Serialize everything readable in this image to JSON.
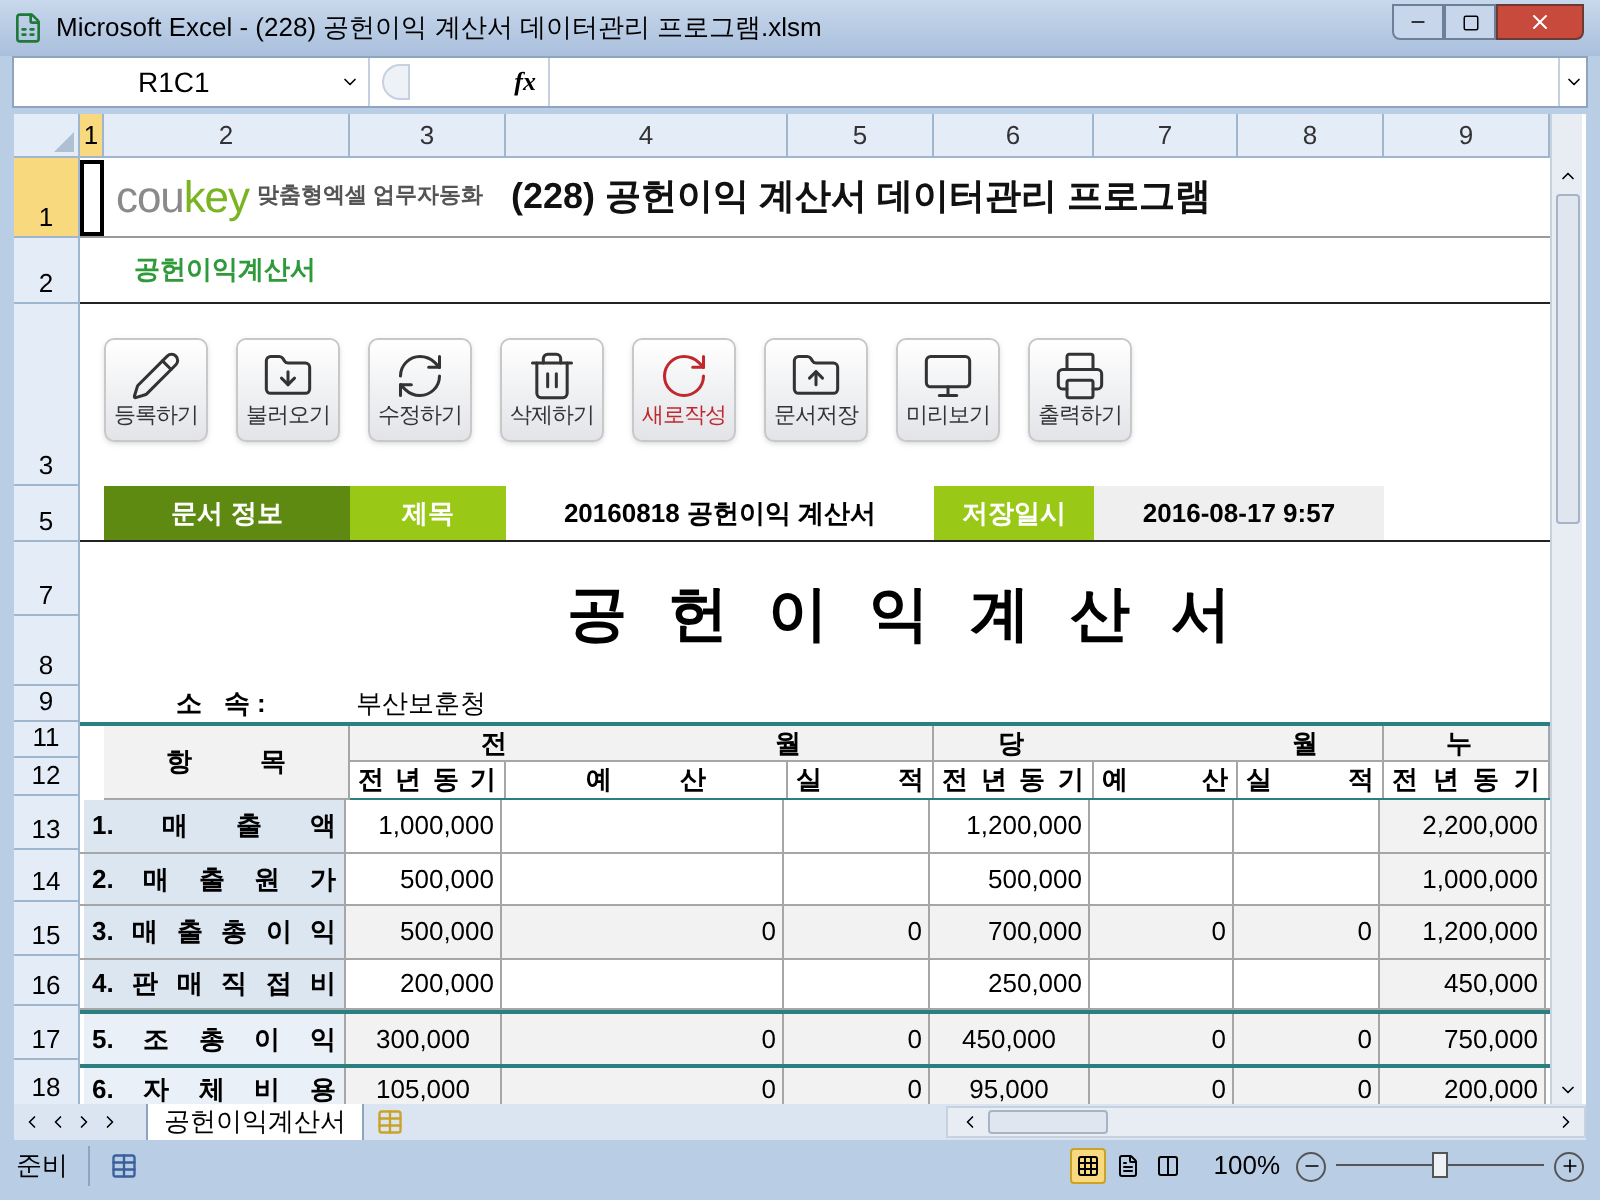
{
  "window": {
    "title": "Microsoft Excel - (228) 공헌이익 계산서 데이터관리 프로그램.xlsm"
  },
  "formula_bar": {
    "name_box": "R1C1",
    "fx": "fx"
  },
  "column_headers": [
    {
      "label": "1",
      "selected": true
    },
    {
      "label": "2",
      "selected": false
    },
    {
      "label": "3",
      "selected": false
    },
    {
      "label": "4",
      "selected": false
    },
    {
      "label": "5",
      "selected": false
    },
    {
      "label": "6",
      "selected": false
    },
    {
      "label": "7",
      "selected": false
    },
    {
      "label": "8",
      "selected": false
    },
    {
      "label": "9",
      "selected": false
    }
  ],
  "row_headers": [
    {
      "label": "1",
      "selected": true
    },
    {
      "label": "2",
      "selected": false
    },
    {
      "label": "3",
      "selected": false
    },
    {
      "label": "5",
      "selected": false
    },
    {
      "label": "7",
      "selected": false
    },
    {
      "label": "8",
      "selected": false
    },
    {
      "label": "9",
      "selected": false
    },
    {
      "label": "11",
      "selected": false
    },
    {
      "label": "12",
      "selected": false
    },
    {
      "label": "13",
      "selected": false
    },
    {
      "label": "14",
      "selected": false
    },
    {
      "label": "15",
      "selected": false
    },
    {
      "label": "16",
      "selected": false
    },
    {
      "label": "17",
      "selected": false
    },
    {
      "label": "18",
      "selected": false
    }
  ],
  "header": {
    "logo": "coukey",
    "tagline": "맞춤형엑셀 업무자동화",
    "title": "(228) 공헌이익 계산서 데이터관리 프로그램",
    "sheet_label": "공헌이익계산서"
  },
  "buttons": [
    {
      "label": "등록하기",
      "kind": "pencil",
      "color": "#333333"
    },
    {
      "label": "불러오기",
      "kind": "download",
      "color": "#333333"
    },
    {
      "label": "수정하기",
      "kind": "refresh",
      "color": "#333333"
    },
    {
      "label": "삭제하기",
      "kind": "trash",
      "color": "#333333"
    },
    {
      "label": "새로작성",
      "kind": "circle",
      "color": "#c0282d"
    },
    {
      "label": "문서저장",
      "kind": "upload",
      "color": "#333333"
    },
    {
      "label": "미리보기",
      "kind": "monitor",
      "color": "#333333"
    },
    {
      "label": "출력하기",
      "kind": "printer",
      "color": "#333333"
    }
  ],
  "info_bar": {
    "section": "문서 정보",
    "title_label": "제목",
    "title_value": "20160818 공헌이익 계산서",
    "date_label": "저장일시",
    "date_value": "2016-08-17 9:57"
  },
  "report": {
    "title": "공 헌 이 익 계 산 서",
    "dept_label": "소   속 :",
    "dept_value": "부산보훈청"
  },
  "table": {
    "item_header": "항 목",
    "groups": [
      "전 월",
      "당 월",
      "누"
    ],
    "subheaders": [
      "전 년 동 기",
      "예 산",
      "실 적",
      "전 년 동 기",
      "예 산",
      "실 적",
      "전 년 동 기"
    ],
    "rows": [
      {
        "kind": "item",
        "label": "1. 매 출 액",
        "cells": [
          "1,000,000",
          null,
          null,
          "1,200,000",
          null,
          null,
          "2,200,000"
        ]
      },
      {
        "kind": "item",
        "label": "2. 매 출 원 가",
        "cells": [
          "500,000",
          null,
          null,
          "500,000",
          null,
          null,
          "1,000,000"
        ]
      },
      {
        "kind": "item",
        "label": "3. 매 출 총 이 익",
        "cells": [
          "500,000",
          "0",
          "0",
          "700,000",
          "0",
          "0",
          "1,200,000"
        ]
      },
      {
        "kind": "item",
        "label": "4. 판 매 직 접 비",
        "cells": [
          "200,000",
          null,
          null,
          "250,000",
          null,
          null,
          "450,000"
        ]
      },
      {
        "kind": "subtotal",
        "label": "5. 조 총 이 익",
        "cells": [
          "300,000",
          "0",
          "0",
          "450,000",
          "0",
          "0",
          "750,000"
        ]
      },
      {
        "kind": "subtotal",
        "label": "6. 자 체 비 용",
        "cells": [
          "105,000",
          "0",
          "0",
          "95,000",
          "0",
          "0",
          "200,000"
        ]
      }
    ]
  },
  "sheet_tabs": [
    {
      "label": "공헌이익계산서",
      "selected": true
    }
  ],
  "status_bar": {
    "status": "준비",
    "zoom": "100%",
    "zoom_slider": {
      "level": 0.5
    },
    "views": [
      {
        "kind": "normal",
        "selected": true
      },
      {
        "kind": "layout",
        "selected": false
      },
      {
        "kind": "pagebreak",
        "selected": false
      }
    ]
  }
}
